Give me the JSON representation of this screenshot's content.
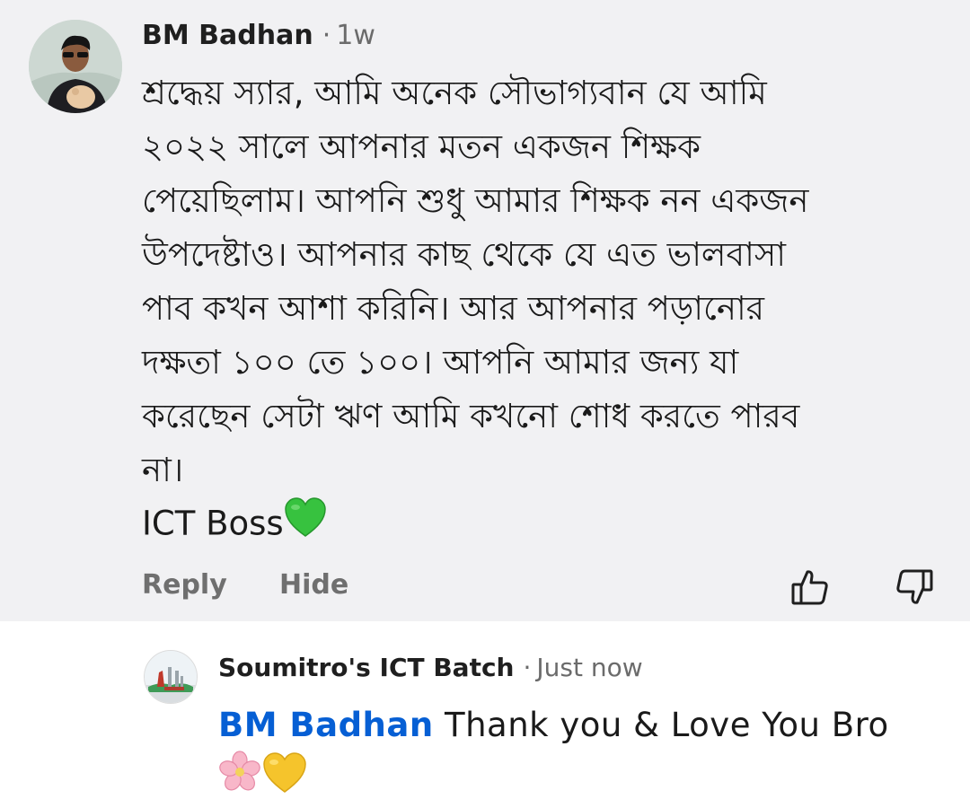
{
  "comment": {
    "author": "BM Badhan",
    "separator": "·",
    "time": "1w",
    "text": "শ্রদ্ধেয় স্যার, আমি অনেক সৌভাগ্যবান যে  আমি\n২০২২ সালে আপনার মতন একজন শিক্ষক\nপেয়েছিলাম। আপনি শুধু আমার শিক্ষক নন একজন\nউপদেষ্টাও। আপনার কাছ থেকে যে এত ভালবাসা\nপাব কখন আশা করিনি। আর আপনার পড়ানোর\nদক্ষতা ১০০ তে ১০০। আপনি আমার জন্য যা\nকরেছেন সেটা ঋণ আমি কখনো শোধ করতে পারব\nনা।",
    "signature": "ICT Boss",
    "signature_emoji": "green-heart-emoji",
    "actions": {
      "reply_label": "Reply",
      "hide_label": "Hide",
      "like_icon": "thumbs-up-icon",
      "dislike_icon": "thumbs-down-icon"
    }
  },
  "reply": {
    "author": "Soumitro's ICT Batch",
    "separator": "·",
    "time": "Just now",
    "mention": "BM Badhan",
    "text": "Thank you & Love You Bro",
    "emojis": [
      "cherry-blossom-emoji",
      "yellow-heart-emoji"
    ]
  },
  "colors": {
    "mention": "#065fd4",
    "highlight_background": "#f1f1f3",
    "secondary_text": "#6b6b6b",
    "action_text": "#6f6f6f"
  }
}
